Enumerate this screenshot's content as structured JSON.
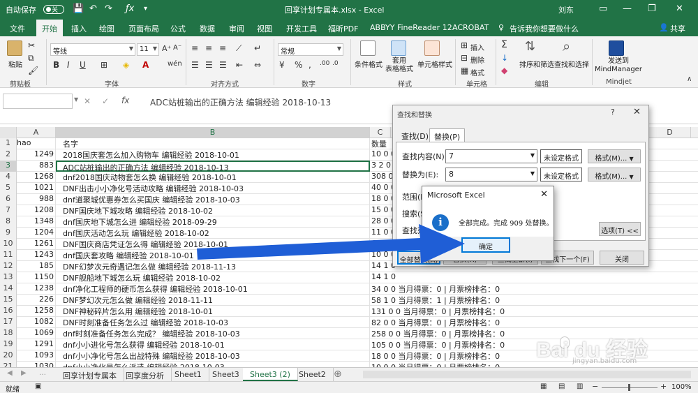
{
  "titlebar": {
    "autosave": "自动保存",
    "autosave_state": "关",
    "title": "回享计划专属本.xlsx  -  Excel",
    "user": "刘东"
  },
  "tabs": [
    "文件",
    "开始",
    "插入",
    "绘图",
    "页面布局",
    "公式",
    "数据",
    "审阅",
    "视图",
    "开发工具",
    "福昕PDF",
    "ABBYY FineReader 12",
    "ACROBAT"
  ],
  "tell_me": "告诉我你想要做什么",
  "share": "共享",
  "ribbon": {
    "paste": "粘贴",
    "clipboard": "剪贴板",
    "font_name": "等线",
    "font_size": "11",
    "font": "字体",
    "align": "对齐方式",
    "number_format": "常规",
    "number": "数字",
    "cond_format": "条件格式",
    "table_format": "套用\n表格格式",
    "cell_style": "单元格样式",
    "styles": "样式",
    "insert": "插入",
    "delete": "删除",
    "format": "格式",
    "cells": "单元格",
    "sort_filter": "排序和筛选",
    "find_select": "查找和选择",
    "editing": "编辑",
    "send_mm": "发送到\nMindManager",
    "mindjet": "Mindjet",
    "sum_sym": "Σ"
  },
  "formula_bar": {
    "fx": "fx",
    "content": "ADC站桩输出的正确方法 编辑经验 2018-10-13"
  },
  "columns": [
    "A",
    "B",
    "C",
    "D"
  ],
  "rows": [
    {
      "n": "1",
      "a": "hao",
      "b": "名字",
      "c": "数量"
    },
    {
      "n": "2",
      "a": "1249",
      "b": "2018国庆套怎么加入购物车 编辑经验 2018-10-01",
      "c": "10 0 0"
    },
    {
      "n": "3",
      "a": "883",
      "b": "ADC站桩输出的正确方法 编辑经验 2018-10-13",
      "c": "3 2 0"
    },
    {
      "n": "4",
      "a": "1268",
      "b": "dnf2018国庆动物套怎么换 编辑经验 2018-10-01",
      "c": "308 0"
    },
    {
      "n": "5",
      "a": "1021",
      "b": "DNF出击小小净化号活动攻略 编辑经验 2018-10-03",
      "c": "40 0 0"
    },
    {
      "n": "6",
      "a": "988",
      "b": "dnf道聚城优惠券怎么买国庆 编辑经验 2018-10-03",
      "c": "18 0 0"
    },
    {
      "n": "7",
      "a": "1208",
      "b": "DNF国庆地下城攻略 编辑经验 2018-10-02",
      "c": "15 0 0"
    },
    {
      "n": "8",
      "a": "1348",
      "b": "dnf国庆地下城怎么进 编辑经验 2018-09-29",
      "c": "28 0 0"
    },
    {
      "n": "9",
      "a": "1204",
      "b": "dnf国庆活动怎么玩 编辑经验 2018-10-02",
      "c": "11 0 0"
    },
    {
      "n": "10",
      "a": "1261",
      "b": "DNF国庆商店凭证怎么得 编辑经验 2018-10-01",
      "c": "69 0 0"
    },
    {
      "n": "11",
      "a": "1243",
      "b": "dnf国庆套攻略 编辑经验 2018-10-01",
      "c": "10 0 0"
    },
    {
      "n": "12",
      "a": "185",
      "b": "DNF幻梦次元奇遇记怎么做 编辑经验 2018-11-13",
      "c": "14 1 0"
    },
    {
      "n": "13",
      "a": "1150",
      "b": "DNF舰船地下城怎么玩 编辑经验 2018-10-02",
      "c": "14 1 0"
    },
    {
      "n": "14",
      "a": "1238",
      "b": "dnf净化工程师的硬币怎么获得 编辑经验 2018-10-01",
      "c": "34 0 0 当月得票：0 | 月票榜排名：0"
    },
    {
      "n": "15",
      "a": "226",
      "b": "DNF梦幻次元怎么做 编辑经验 2018-11-11",
      "c": "58 1 0 当月得票：1 | 月票榜排名：0"
    },
    {
      "n": "16",
      "a": "1258",
      "b": "DNF神秘碎片怎么用 编辑经验 2018-10-01",
      "c": "131 0 0 当月得票：0 | 月票榜排名：0"
    },
    {
      "n": "17",
      "a": "1082",
      "b": "DNF时刻准备任务怎么过 编辑经验 2018-10-03",
      "c": "82 0 0 当月得票：0 | 月票榜排名：0"
    },
    {
      "n": "18",
      "a": "1069",
      "b": "dnf时刻准备任务怎么完成？ 编辑经验 2018-10-03",
      "c": "258 0 0 当月得票：0 | 月票榜排名：0"
    },
    {
      "n": "19",
      "a": "1291",
      "b": "dnf小小进化号怎么获得 编辑经验 2018-10-01",
      "c": "105 0 0 当月得票：0 | 月票榜排名：0"
    },
    {
      "n": "20",
      "a": "1093",
      "b": "dnf小小净化号怎么出战特殊 编辑经验 2018-10-03",
      "c": "18 0 0 当月得票：0 | 月票榜排名：0"
    },
    {
      "n": "21",
      "a": "1030",
      "b": "dnf小小净化号怎么派遣 编辑经验 2018-10-03",
      "c": "10 0 0 当月得票：0 | 月票榜排名：0"
    },
    {
      "n": "22",
      "a": "1090",
      "b": "dnf小小净化号怎么去特殊 编辑经验 2018-10-03",
      "c": "82 0 0 当月得票：0 | 月票榜排名：0"
    }
  ],
  "sheets": [
    "回享计划专属本",
    "回享度分析",
    "Sheet1",
    "Sheet3",
    "Sheet3 (2)",
    "Sheet2"
  ],
  "active_sheet": "Sheet3 (2)",
  "status": {
    "ready": "就绪",
    "zoom": "100%"
  },
  "find_dialog": {
    "title": "查找和替换",
    "help": "?",
    "tab_find": "查找(D)",
    "tab_replace": "替换(P)",
    "find_label": "查找内容(N):",
    "find_value": "7",
    "replace_label": "替换为(E):",
    "replace_value": "8",
    "no_format": "未设定格式",
    "format_btn": "格式(M)...",
    "scope_label": "范围(H",
    "search_label": "搜索(S",
    "lookin_label": "查找范",
    "options_btn": "选项(T) <<",
    "replace_all": "全部替换(A)",
    "replace": "替换(R)",
    "find_all": "查找全部(I)",
    "find_next": "查找下一个(F)",
    "close": "关闭"
  },
  "msgbox": {
    "title": "Microsoft Excel",
    "text": "全部完成。完成 909 处替换。",
    "ok": "确定"
  },
  "watermark": {
    "brand": "Bai du 经验",
    "url": "jingyan.baidu.com"
  },
  "colors": {
    "excel_green": "#217346",
    "arrow_blue": "#1f5ed6",
    "info_blue": "#1a6fc9"
  }
}
